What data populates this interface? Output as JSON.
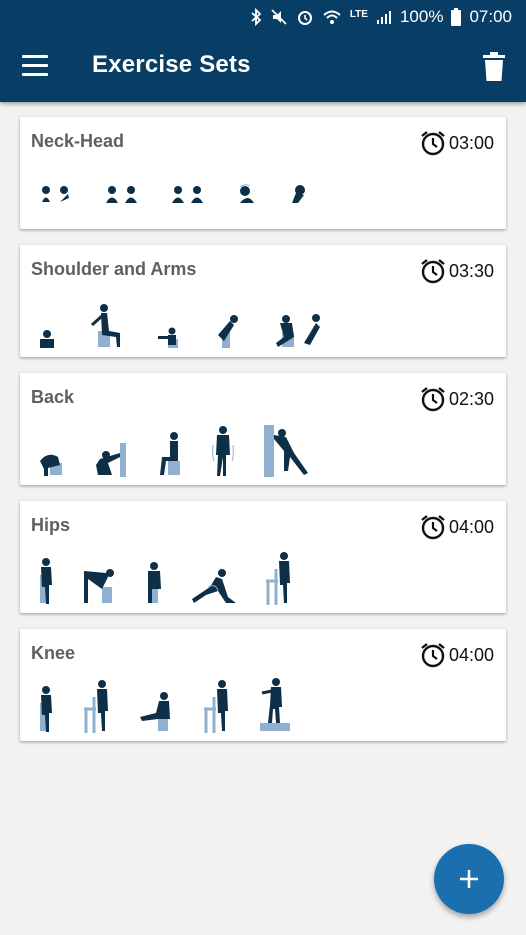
{
  "status_bar": {
    "battery": "100%",
    "time": "07:00",
    "network": "LTE"
  },
  "app_bar": {
    "title": "Exercise Sets"
  },
  "exercise_sets": [
    {
      "name": "Neck-Head",
      "duration": "03:00"
    },
    {
      "name": "Shoulder and Arms",
      "duration": "03:30"
    },
    {
      "name": "Back",
      "duration": "02:30"
    },
    {
      "name": "Hips",
      "duration": "04:00"
    },
    {
      "name": "Knee",
      "duration": "04:00"
    }
  ],
  "colors": {
    "primary": "#083e66",
    "fab": "#1b6fae",
    "figure": "#0d2f47",
    "prop": "#8fb0cf"
  }
}
